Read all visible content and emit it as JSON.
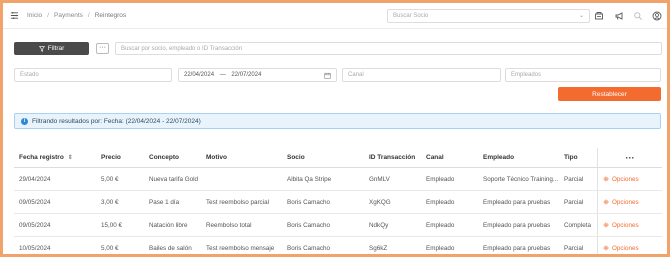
{
  "breadcrumb": [
    "Inicio",
    "Payments",
    "Reintegros"
  ],
  "search_partner": {
    "placeholder": "Buscar Socio"
  },
  "toolbar": {
    "filter_label": "Filtrar",
    "more_label": "···",
    "search_placeholder": "Buscar por socio, empleado o ID Transacción"
  },
  "filters": {
    "estado_placeholder": "Estado",
    "date_from": "22/04/2024",
    "date_separator": "—",
    "date_to": "22/07/2024",
    "canal_placeholder": "Canal",
    "empleados_placeholder": "Empleados",
    "reset_label": "Restablecer"
  },
  "info": {
    "text": "Filtrando resultados por: Fecha: (22/04/2024 - 22/07/2024)"
  },
  "table": {
    "headers": [
      "Fecha registro",
      "Precio",
      "Concepto",
      "Motivo",
      "Socio",
      "ID Transacción",
      "Canal",
      "Empleado",
      "Tipo",
      "···"
    ],
    "rows": [
      [
        "29/04/2024",
        "5,00 €",
        "Nueva tarifa Gold",
        "",
        "Albita Qa Stripe",
        "GnMLV",
        "Empleado",
        "Soporte Técnico Training...",
        "Parcial",
        "Opciones"
      ],
      [
        "09/05/2024",
        "3,00 €",
        "Pase 1 día",
        "Test reembolso parcial",
        "Boris Camacho",
        "XgKQG",
        "Empleado",
        "Empleado para pruebas",
        "Parcial",
        "Opciones"
      ],
      [
        "09/05/2024",
        "15,00 €",
        "Natación libre",
        "Reembolso total",
        "Boris Camacho",
        "NdkQy",
        "Empleado",
        "Empleado para pruebas",
        "Completa",
        "Opciones"
      ],
      [
        "10/05/2024",
        "5,00 €",
        "Bailes de salón",
        "Test reembolso mensaje",
        "Boris Camacho",
        "Sg6kZ",
        "Empleado",
        "Empleado para pruebas",
        "Parcial",
        "Opciones"
      ]
    ]
  },
  "colors": {
    "accent": "#f46b2f",
    "info_bg": "#e9f3fb",
    "filter_btn": "#4a4a4a"
  }
}
